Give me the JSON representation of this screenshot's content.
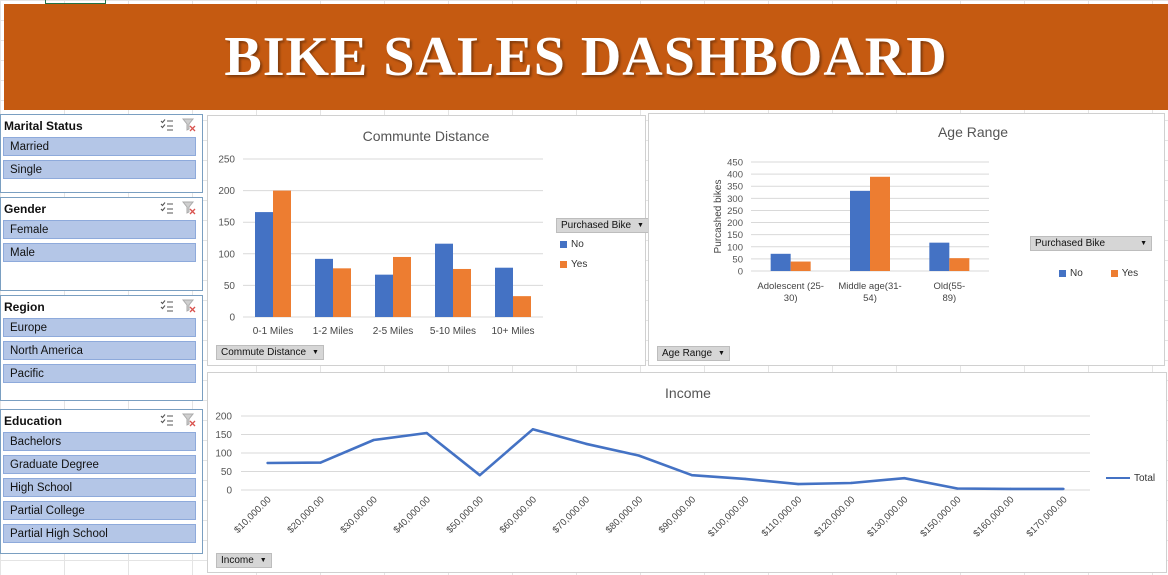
{
  "banner": {
    "title": "BIKE SALES DASHBOARD"
  },
  "colors": {
    "banner": "#c55a11",
    "series_no": "#4472c4",
    "series_yes": "#ed7d31",
    "slicer_item": "#b4c6e7",
    "line": "#4472c4"
  },
  "icons": {
    "multi_select": "multi-select-icon",
    "clear_filter": "clear-filter-icon",
    "dropdown": "dropdown-arrow-icon"
  },
  "slicers": {
    "marital": {
      "title": "Marital Status",
      "items": [
        "Married",
        "Single"
      ]
    },
    "gender": {
      "title": "Gender",
      "items": [
        "Female",
        "Male"
      ]
    },
    "region": {
      "title": "Region",
      "items": [
        "Europe",
        "North America",
        "Pacific"
      ]
    },
    "education": {
      "title": "Education",
      "items": [
        "Bachelors",
        "Graduate Degree",
        "High School",
        "Partial College",
        "Partial High School"
      ]
    }
  },
  "commute": {
    "field_button": "Commute Distance",
    "legend_button": "Purchased Bike",
    "legend": [
      "No",
      "Yes"
    ]
  },
  "age": {
    "field_button": "Age Range",
    "legend_button": "Purchased Bike",
    "legend": [
      "No",
      "Yes"
    ]
  },
  "income": {
    "field_button": "Income",
    "legend": [
      "Total"
    ]
  },
  "chart_data": [
    {
      "type": "bar",
      "title": "Communte Distance",
      "xlabel": "",
      "ylabel": "",
      "categories": [
        "0-1 Miles",
        "1-2 Miles",
        "2-5 Miles",
        "5-10 Miles",
        "10+ Miles"
      ],
      "ylim": [
        0,
        250
      ],
      "yticks": [
        0,
        50,
        100,
        150,
        200,
        250
      ],
      "grid": true,
      "legend_position": "right",
      "series": [
        {
          "name": "No",
          "values": [
            166,
            92,
            67,
            116,
            78
          ]
        },
        {
          "name": "Yes",
          "values": [
            200,
            77,
            95,
            76,
            33
          ]
        }
      ]
    },
    {
      "type": "bar",
      "title": "Age Range",
      "xlabel": "",
      "ylabel": "Purcashed bikes",
      "categories": [
        "Adolescent (25-30)",
        "Middle age(31-54)",
        "Old(55-89)"
      ],
      "ylim": [
        0,
        450
      ],
      "yticks": [
        0,
        50,
        100,
        150,
        200,
        250,
        300,
        350,
        400,
        450
      ],
      "grid": true,
      "legend_position": "right",
      "series": [
        {
          "name": "No",
          "values": [
            71,
            331,
            117
          ]
        },
        {
          "name": "Yes",
          "values": [
            39,
            389,
            53
          ]
        }
      ]
    },
    {
      "type": "line",
      "title": "Income",
      "xlabel": "",
      "ylabel": "",
      "categories": [
        "$10,000.00",
        "$20,000.00",
        "$30,000.00",
        "$40,000.00",
        "$50,000.00",
        "$60,000.00",
        "$70,000.00",
        "$80,000.00",
        "$90,000.00",
        "$100,000.00",
        "$110,000.00",
        "$120,000.00",
        "$130,000.00",
        "$150,000.00",
        "$160,000.00",
        "$170,000.00"
      ],
      "ylim": [
        0,
        200
      ],
      "yticks": [
        0,
        50,
        100,
        150,
        200
      ],
      "grid": true,
      "legend_position": "right",
      "series": [
        {
          "name": "Total",
          "values": [
            73,
            74,
            135,
            154,
            40,
            164,
            125,
            93,
            40,
            30,
            16,
            19,
            32,
            4,
            3,
            3
          ]
        }
      ]
    }
  ]
}
